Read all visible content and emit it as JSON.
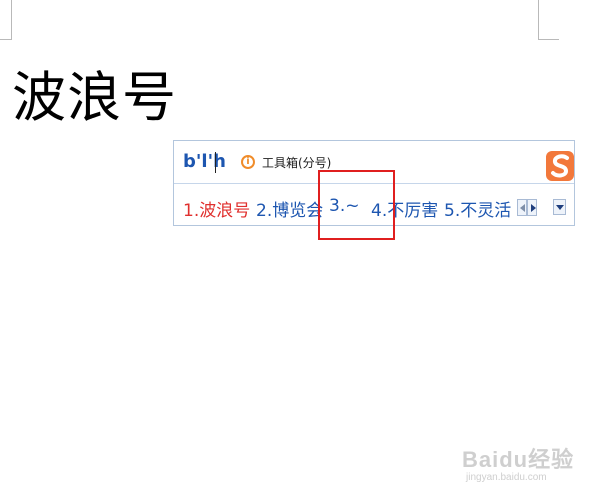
{
  "document": {
    "typed_text": "波浪号"
  },
  "ime": {
    "pinyin_input": "b'l'h",
    "toolbox_label": "工具箱(分号)",
    "candidates": [
      {
        "label": "1.波浪号"
      },
      {
        "label": "2.博览会"
      },
      {
        "label": "3.~"
      },
      {
        "label": "4.不厉害"
      },
      {
        "label": "5.不灵活"
      }
    ],
    "logo_icon": "sogou-s-icon",
    "toolbox_icon": "info-circle-icon",
    "colors": {
      "selected_candidate": "#e0302e",
      "candidate": "#1d56b0",
      "border": "#b3c6dd"
    }
  },
  "annotation": {
    "highlight_color": "#e01f1f"
  },
  "watermark": {
    "brand": "Baidu经验",
    "url": "jingyan.baidu.com"
  }
}
